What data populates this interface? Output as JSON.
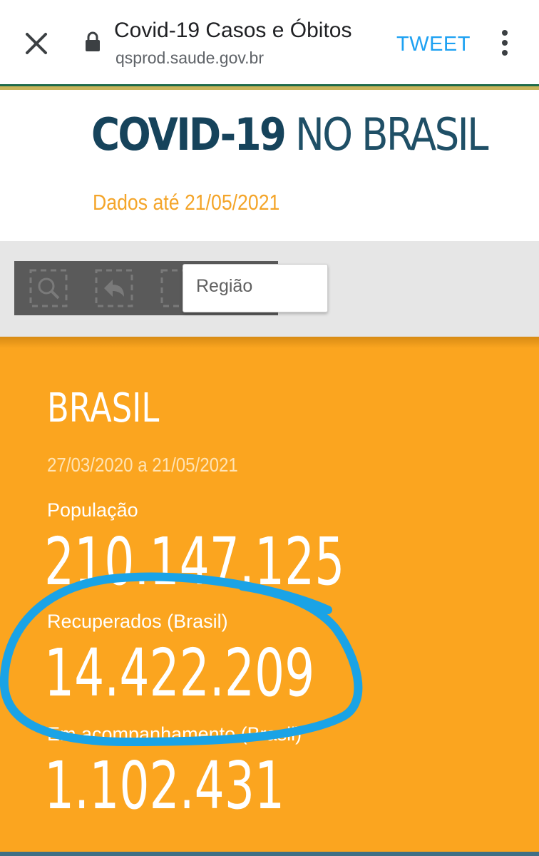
{
  "browser": {
    "close_icon": "close-icon",
    "lock_icon": "lock-icon",
    "title": "Covid-19 Casos e Óbitos",
    "url": "qsprod.saude.gov.br",
    "tweet_label": "TWEET",
    "menu_icon": "more-vert-icon",
    "link_color": "#1da1f2"
  },
  "header": {
    "title_bold": "COVID-19",
    "title_light": "NO BRASIL",
    "data_date": "Dados até 21/05/2021",
    "title_color": "#16435b",
    "date_color": "#f4a52a"
  },
  "toolbar": {
    "icons": [
      "search-selection-icon",
      "back-selection-icon",
      "selection-icon"
    ],
    "region_select": "Região"
  },
  "panel": {
    "background": "#fba51f",
    "region": "BRASIL",
    "period": "27/03/2020 a 21/05/2021",
    "stats": [
      {
        "label": "População",
        "value": "210.147.125"
      },
      {
        "label": "Recuperados (Brasil)",
        "value": "14.422.209"
      },
      {
        "label": "Em acompanhamento (Brasil)",
        "value": "1.102.431"
      }
    ],
    "highlight_color": "#1aa3e6"
  }
}
